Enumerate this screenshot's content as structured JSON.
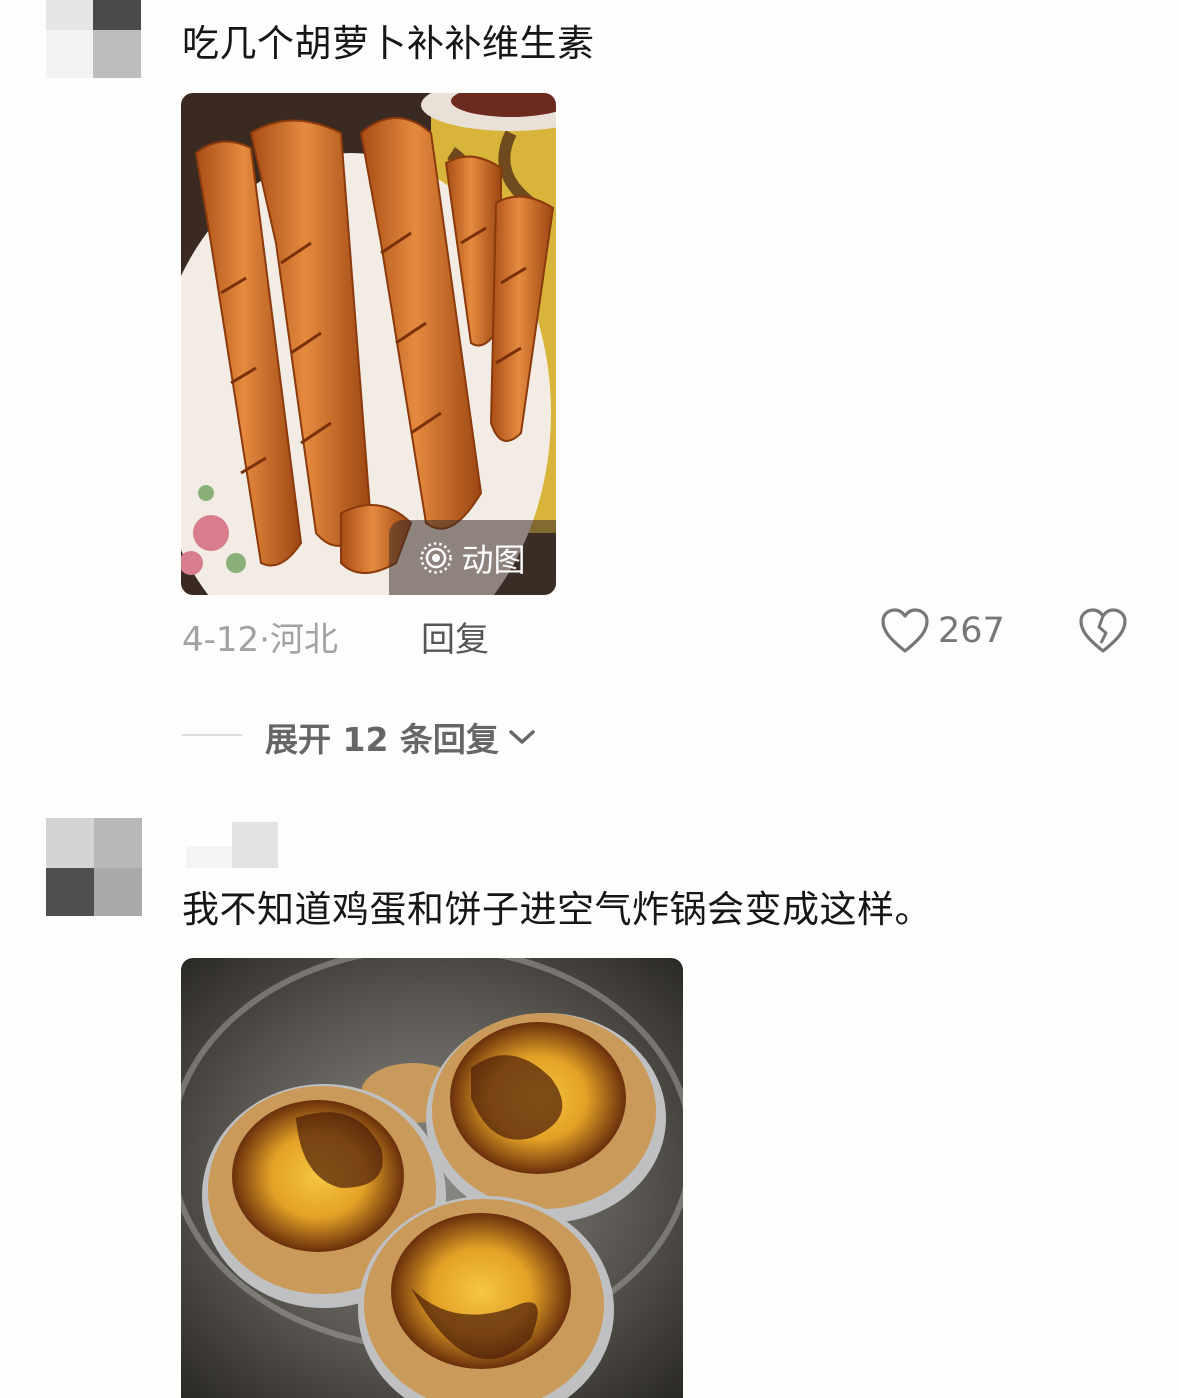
{
  "comments": [
    {
      "text": "吃几个胡萝卜补补维生素",
      "image_badge": "动图",
      "date": "4-12",
      "location": "河北",
      "reply_label": "回复",
      "likes": "267",
      "expand_label": "展开 12 条回复"
    },
    {
      "text": "我不知道鸡蛋和饼子进空气炸锅会变成这样。"
    }
  ],
  "icons": {
    "like": "heart-icon",
    "dislike": "broken-heart-icon",
    "badge": "live-photo-icon",
    "expand": "chevron-down-icon"
  },
  "colors": {
    "background": "#fdfdfb",
    "text": "#161616",
    "meta": "#a2a2a2",
    "icon": "#777777"
  }
}
